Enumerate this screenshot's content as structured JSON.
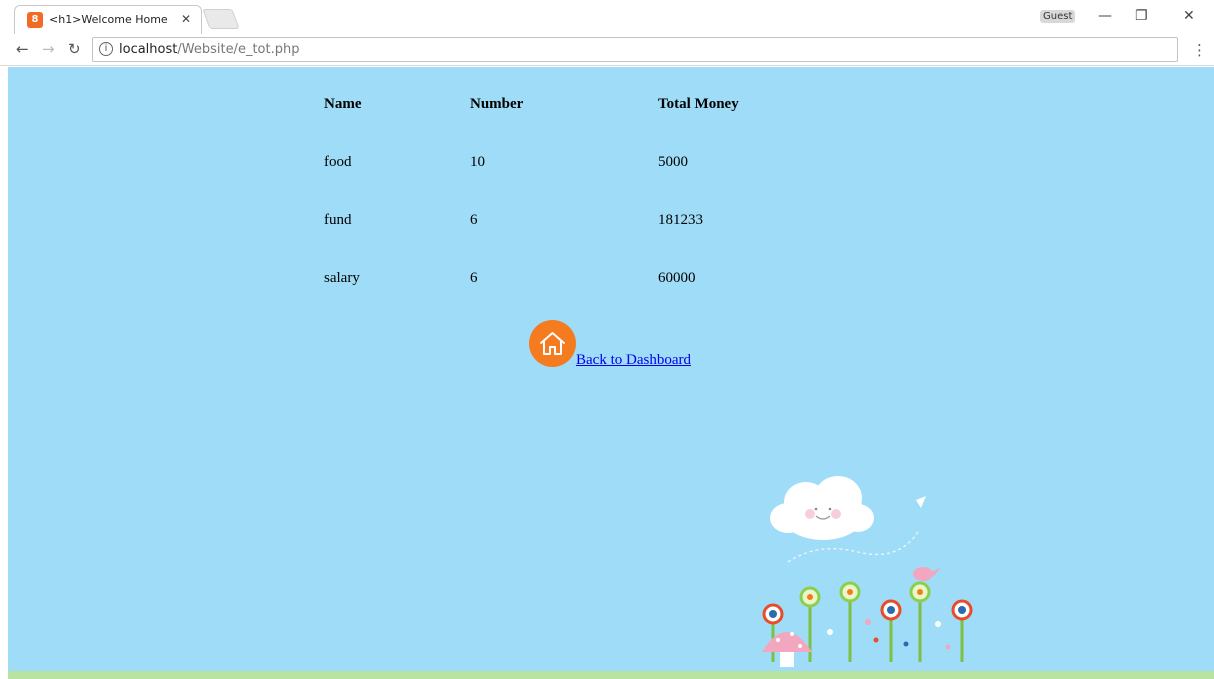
{
  "browser": {
    "tab_title": "<h1>Welcome Home</",
    "tab_favicon_text": "8",
    "profile_label": "Guest",
    "url_host": "localhost",
    "url_path": "/Website/e_tot.php",
    "info_icon": "info-icon",
    "back_icon": "back-arrow-icon",
    "forward_icon": "forward-arrow-icon",
    "reload_icon": "reload-icon",
    "menu_icon": "menu-dots-icon"
  },
  "table": {
    "headers": [
      "Name",
      "Number",
      "Total Money"
    ],
    "rows": [
      [
        "food",
        "10",
        "5000"
      ],
      [
        "fund",
        "6",
        "181233"
      ],
      [
        "salary",
        "6",
        "60000"
      ]
    ]
  },
  "dashboard_link": {
    "label": "Back to Dashboard",
    "icon": "home-icon",
    "icon_color": "#f47b20"
  },
  "colors": {
    "page_background": "#9fdcf7",
    "link": "#0000ee"
  }
}
